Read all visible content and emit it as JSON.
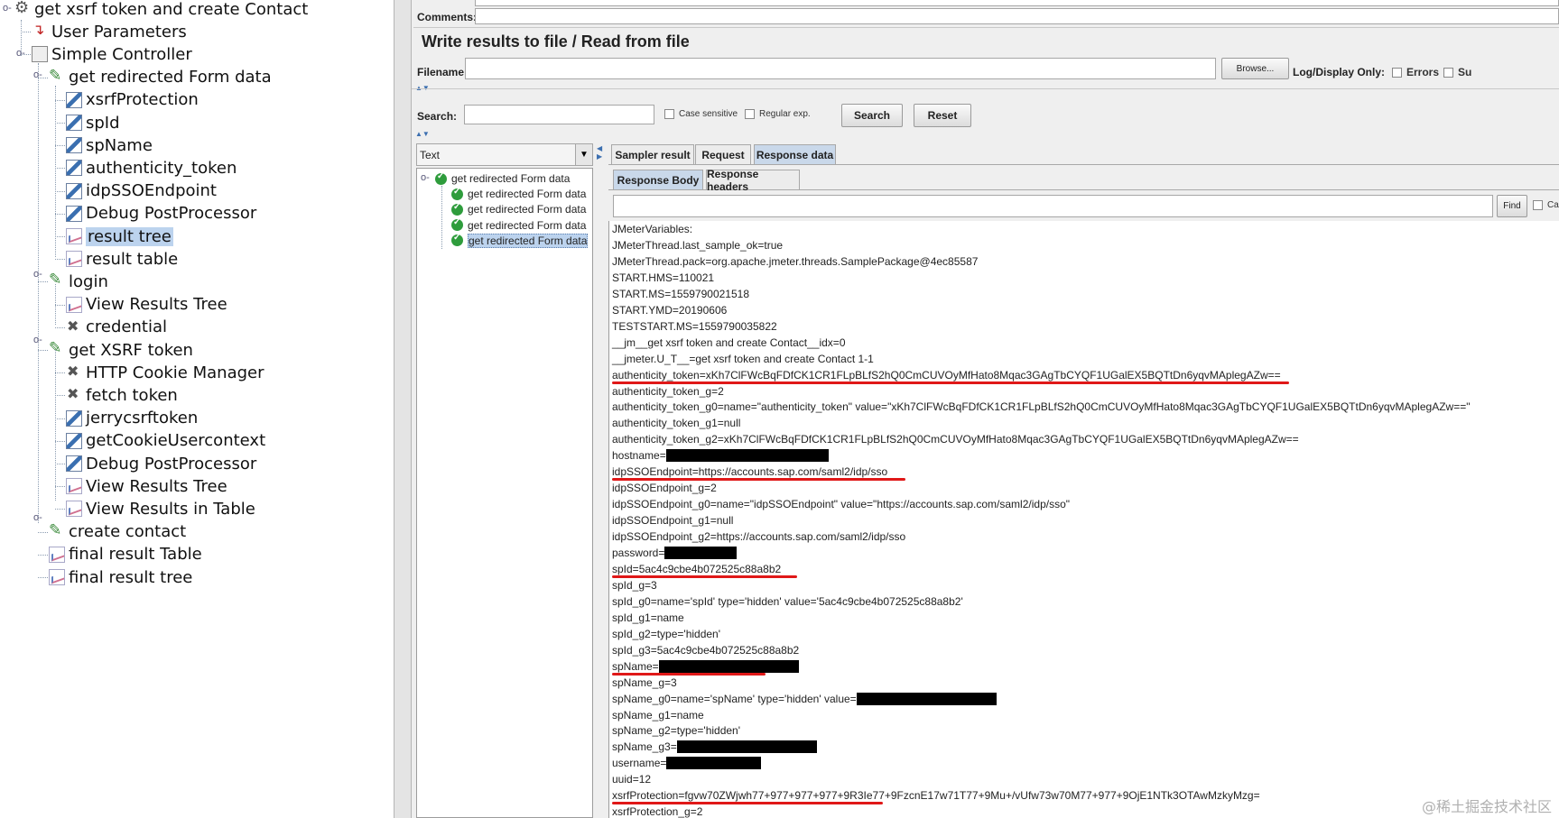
{
  "tree": {
    "items": [
      {
        "label": "get xsrf token and create Contact",
        "icon": "gear-icon"
      },
      {
        "label": "User Parameters",
        "icon": "parameters-icon"
      },
      {
        "label": "Simple Controller",
        "icon": "controller-icon"
      },
      {
        "label": "get redirected Form data",
        "icon": "http-sampler-icon"
      },
      {
        "label": "xsrfProtection",
        "icon": "extractor-icon"
      },
      {
        "label": "spId",
        "icon": "extractor-icon"
      },
      {
        "label": "spName",
        "icon": "extractor-icon"
      },
      {
        "label": "authenticity_token",
        "icon": "extractor-icon"
      },
      {
        "label": "idpSSOEndpoint",
        "icon": "extractor-icon"
      },
      {
        "label": "Debug PostProcessor",
        "icon": "extractor-icon"
      },
      {
        "label": "result tree",
        "icon": "listener-icon",
        "selected": true
      },
      {
        "label": "result table",
        "icon": "listener-icon"
      },
      {
        "label": "login",
        "icon": "http-sampler-icon"
      },
      {
        "label": "View Results Tree",
        "icon": "listener-icon"
      },
      {
        "label": "credential",
        "icon": "config-tools-icon"
      },
      {
        "label": "get XSRF token",
        "icon": "http-sampler-icon"
      },
      {
        "label": "HTTP Cookie Manager",
        "icon": "config-tools-icon"
      },
      {
        "label": "fetch token",
        "icon": "config-tools-icon"
      },
      {
        "label": "jerrycsrftoken",
        "icon": "extractor-icon"
      },
      {
        "label": "getCookieUsercontext",
        "icon": "extractor-icon"
      },
      {
        "label": "Debug PostProcessor",
        "icon": "extractor-icon"
      },
      {
        "label": "View Results Tree",
        "icon": "listener-icon"
      },
      {
        "label": "View Results in Table",
        "icon": "listener-icon"
      },
      {
        "label": "create contact",
        "icon": "http-sampler-icon"
      },
      {
        "label": "final result Table",
        "icon": "listener-icon"
      },
      {
        "label": "final result tree",
        "icon": "listener-icon"
      }
    ]
  },
  "form": {
    "comments_label": "Comments:",
    "section_title": "Write results to file / Read from file",
    "filename_label": "Filename",
    "browse_label": "Browse...",
    "log_display_label": "Log/Display Only:",
    "errors_label": "Errors",
    "successes_label": "Su"
  },
  "search": {
    "label": "Search:",
    "case_sensitive_label": "Case sensitive",
    "regex_label": "Regular exp.",
    "search_button": "Search",
    "reset_button": "Reset"
  },
  "renderer": {
    "selected": "Text"
  },
  "samples": [
    {
      "label": "get redirected Form data"
    },
    {
      "label": "get redirected Form data"
    },
    {
      "label": "get redirected Form data"
    },
    {
      "label": "get redirected Form data"
    },
    {
      "label": "get redirected Form data",
      "selected": true
    }
  ],
  "tabs": {
    "main": [
      "Sampler result",
      "Request",
      "Response data"
    ],
    "main_active": "Response data",
    "sub": [
      "Response Body",
      "Response headers"
    ],
    "sub_active": "Response Body"
  },
  "find": {
    "button": "Find",
    "case_label": "Case"
  },
  "response_lines": [
    {
      "text": "JMeterVariables:"
    },
    {
      "text": "JMeterThread.last_sample_ok=true"
    },
    {
      "text": "JMeterThread.pack=org.apache.jmeter.threads.SamplePackage@4ec85587"
    },
    {
      "text": "START.HMS=110021"
    },
    {
      "text": "START.MS=1559790021518"
    },
    {
      "text": "START.YMD=20190606"
    },
    {
      "text": "TESTSTART.MS=1559790035822"
    },
    {
      "text": "__jm__get xsrf token and create Contact__idx=0"
    },
    {
      "text": "__jmeter.U_T__=get xsrf token and create Contact 1-1"
    },
    {
      "text": "authenticity_token=xKh7ClFWcBqFDfCK1CR1FLpBLfS2hQ0CmCUVOyMfHato8Mqac3GAgTbCYQF1UGalEX5BQTtDn6yqvMAplegAZw==",
      "highlight": true
    },
    {
      "text": "authenticity_token_g=2"
    },
    {
      "text": "authenticity_token_g0=name=\"authenticity_token\" value=\"xKh7ClFWcBqFDfCK1CR1FLpBLfS2hQ0CmCUVOyMfHato8Mqac3GAgTbCYQF1UGalEX5BQTtDn6yqvMAplegAZw==\""
    },
    {
      "text": "authenticity_token_g1=null"
    },
    {
      "text": "authenticity_token_g2=xKh7ClFWcBqFDfCK1CR1FLpBLfS2hQ0CmCUVOyMfHato8Mqac3GAgTbCYQF1UGalEX5BQTtDn6yqvMAplegAZw=="
    },
    {
      "text": "hostname=",
      "redacted": true
    },
    {
      "text": "idpSSOEndpoint=https://accounts.sap.com/saml2/idp/sso",
      "highlight": true
    },
    {
      "text": "idpSSOEndpoint_g=2"
    },
    {
      "text": "idpSSOEndpoint_g0=name=\"idpSSOEndpoint\" value=\"https://accounts.sap.com/saml2/idp/sso\""
    },
    {
      "text": "idpSSOEndpoint_g1=null"
    },
    {
      "text": "idpSSOEndpoint_g2=https://accounts.sap.com/saml2/idp/sso"
    },
    {
      "text": "password=",
      "redacted": true
    },
    {
      "text": "spId=5ac4c9cbe4b072525c88a8b2",
      "highlight": true
    },
    {
      "text": "spId_g=3"
    },
    {
      "text": "spId_g0=name='spId' type='hidden' value='5ac4c9cbe4b072525c88a8b2'"
    },
    {
      "text": "spId_g1=name"
    },
    {
      "text": "spId_g2=type='hidden'"
    },
    {
      "text": "spId_g3=5ac4c9cbe4b072525c88a8b2"
    },
    {
      "text": "spName=",
      "redacted": true,
      "highlight": true
    },
    {
      "text": "spName_g=3"
    },
    {
      "text": "spName_g0=name='spName' type='hidden' value=",
      "redacted": true
    },
    {
      "text": "spName_g1=name"
    },
    {
      "text": "spName_g2=type='hidden'"
    },
    {
      "text": "spName_g3=",
      "redacted": true
    },
    {
      "text": "username=",
      "redacted": true
    },
    {
      "text": "uuid=12"
    },
    {
      "text": "xsrfProtection=fgvw70ZWjwh77+977+977+977+9R3Ie77+9FzcnE17w71T77+9Mu+/vUfw73w70M77+977+9OjE1NTk3OTAwMzkyMzg=",
      "highlight": true
    },
    {
      "text": "xsrfProtection_g=2"
    }
  ],
  "watermark": "@稀土掘金技术社区",
  "colors": {
    "highlight_underline": "#e01818",
    "selection": "#bcd3ee",
    "active_tab": "#c9d8ea"
  }
}
